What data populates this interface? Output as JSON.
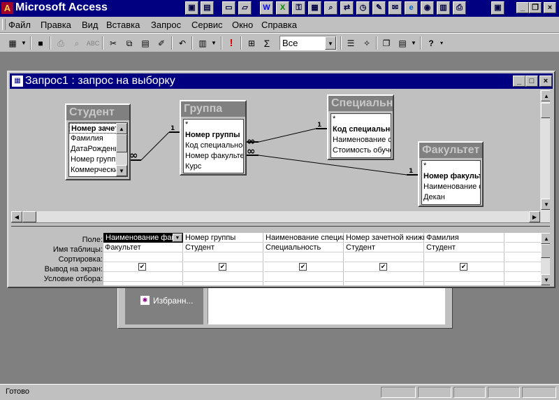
{
  "app": {
    "title": "Microsoft Access"
  },
  "menu": [
    "Файл",
    "Правка",
    "Вид",
    "Вставка",
    "Запрос",
    "Сервис",
    "Окно",
    "Справка"
  ],
  "toolbar": {
    "top_values": "Все"
  },
  "db_window": {
    "favorites_label": "Избранн..."
  },
  "query_window": {
    "title": "Запрос1 : запрос на выборку",
    "tables": [
      {
        "name": "Студент",
        "fields": [
          "Номер зачетной",
          "Фамилия",
          "ДатаРождения",
          "Номер группы",
          "Коммерческий"
        ],
        "key_index": 0
      },
      {
        "name": "Группа",
        "fields": [
          "*",
          "Номер группы",
          "Код специальности",
          "Номер факультета",
          "Курс"
        ],
        "key_index": 1
      },
      {
        "name": "Специальность",
        "fields": [
          "*",
          "Код специальности",
          "Наименование специальности",
          "Стоимость обучения"
        ],
        "key_index": 1
      },
      {
        "name": "Факультет",
        "fields": [
          "*",
          "Номер факультета",
          "Наименование факультета",
          "Декан"
        ],
        "key_index": 1
      }
    ],
    "relations": [
      {
        "from_label": "∞",
        "to_label": "1"
      },
      {
        "from_label": "∞",
        "to_label": "1"
      },
      {
        "from_label": "∞",
        "to_label": "1"
      }
    ],
    "grid": {
      "row_labels": [
        "Поле:",
        "Имя таблицы:",
        "Сортировка:",
        "Вывод на экран:",
        "Условие отбора:"
      ],
      "columns": [
        {
          "field": "Наименование факультета",
          "table": "Факультет",
          "show": true
        },
        {
          "field": "Номер группы",
          "table": "Студент",
          "show": true
        },
        {
          "field": "Наименование специальности",
          "table": "Специальность",
          "show": true
        },
        {
          "field": "Номер зачетной книжки",
          "table": "Студент",
          "show": true
        },
        {
          "field": "Фамилия",
          "table": "Студент",
          "show": true
        },
        {
          "field": "",
          "table": "",
          "show": false
        }
      ]
    }
  },
  "status": {
    "text": "Готово"
  }
}
